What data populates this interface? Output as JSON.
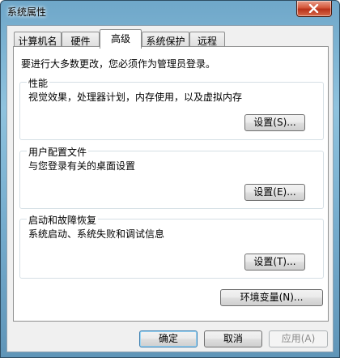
{
  "window": {
    "title": "系统属性"
  },
  "tabs": [
    {
      "label": "计算机名"
    },
    {
      "label": "硬件"
    },
    {
      "label": "高级"
    },
    {
      "label": "系统保护"
    },
    {
      "label": "远程"
    }
  ],
  "active_tab": "高级",
  "notice": "要进行大多数更改，您必须作为管理员登录。",
  "performance": {
    "title": "性能",
    "description": "视觉效果，处理器计划，内存使用，以及虚拟内存",
    "button": "设置(S)..."
  },
  "user_profiles": {
    "title": "用户配置文件",
    "description": "与您登录有关的桌面设置",
    "button": "设置(E)..."
  },
  "startup_recovery": {
    "title": "启动和故障恢复",
    "description": "系统启动、系统失败和调试信息",
    "button": "设置(T)..."
  },
  "env_button": "环境变量(N)...",
  "footer": {
    "ok": "确定",
    "cancel": "取消",
    "apply": "应用(A)"
  }
}
